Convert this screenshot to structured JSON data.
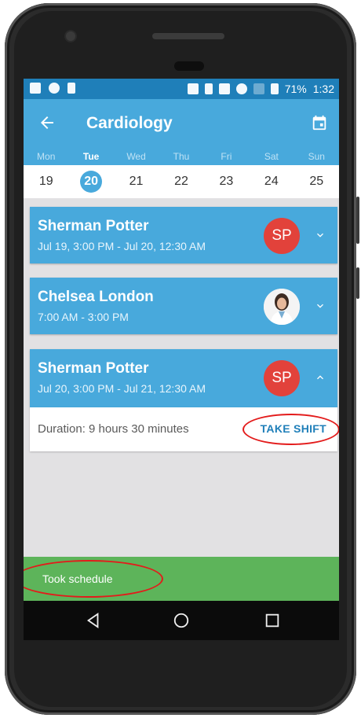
{
  "status_bar": {
    "battery": "71%",
    "time": "1:32"
  },
  "app_bar": {
    "title": "Cardiology",
    "back_icon": "arrow-left-icon",
    "calendar_icon": "calendar-icon"
  },
  "week": {
    "days": [
      {
        "name": "Mon",
        "date": "19"
      },
      {
        "name": "Tue",
        "date": "20"
      },
      {
        "name": "Wed",
        "date": "21"
      },
      {
        "name": "Thu",
        "date": "22"
      },
      {
        "name": "Fri",
        "date": "23"
      },
      {
        "name": "Sat",
        "date": "24"
      },
      {
        "name": "Sun",
        "date": "25"
      }
    ],
    "selected_index": 1
  },
  "shifts": [
    {
      "name": "Sherman Potter",
      "time": "Jul 19, 3:00 PM - Jul 20, 12:30 AM",
      "avatar_text": "SP",
      "expanded": false
    },
    {
      "name": "Chelsea London",
      "time": "7:00 AM - 3:00 PM",
      "avatar_text": "",
      "expanded": false
    },
    {
      "name": "Sherman Potter",
      "time": "Jul 20, 3:00 PM - Jul 21, 12:30 AM",
      "avatar_text": "SP",
      "expanded": true
    }
  ],
  "details": {
    "duration": "Duration: 9 hours 30 minutes",
    "take_shift_label": "TAKE SHIFT"
  },
  "snackbar": {
    "text": "Took schedule"
  },
  "colors": {
    "primary": "#48a9dc",
    "primary_dark": "#1f7fb9",
    "avatar": "#e2423b",
    "snackbar": "#5db45a",
    "highlight_ring": "#e31b1b"
  }
}
